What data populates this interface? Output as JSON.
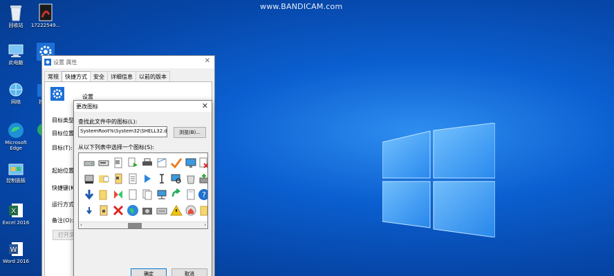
{
  "watermark": "www.BANDICAM.com",
  "desktop": {
    "icons": [
      {
        "label": "回收站",
        "icon": "recycle-bin-icon"
      },
      {
        "label": "17222549...",
        "icon": "image-file-icon"
      },
      {
        "label": "此电脑",
        "icon": "computer-icon"
      },
      {
        "label": "网络",
        "icon": "network-icon"
      },
      {
        "label": "控制面板",
        "icon": "control-panel-icon"
      },
      {
        "label": "Microsoft Edge",
        "icon": "edge-icon"
      },
      {
        "label": "Excel 2016",
        "icon": "excel-icon"
      },
      {
        "label": "Word 2016",
        "icon": "word-icon"
      },
      {
        "label": "控制",
        "icon": "settings-icon"
      }
    ]
  },
  "properties_dialog": {
    "title": "设置 属性",
    "tabs": [
      "常规",
      "快捷方式",
      "安全",
      "详细信息",
      "以前的版本"
    ],
    "active_tab": "快捷方式",
    "app_name": "设置",
    "fields": [
      "目标类型:",
      "目标位置:",
      "目标(T):",
      "起始位置(S):",
      "快捷键(K):",
      "运行方式(R):",
      "备注(O):"
    ],
    "open_location_button": "打开文"
  },
  "change_icon_dialog": {
    "title": "更改图标",
    "find_label": "查找此文件中的图标(L):",
    "path_value": "SystemRoot%\\System32\\SHELL32.dll",
    "browse_button": "浏览(B)...",
    "select_label": "从以下列表中选择一个图标(S):",
    "ok_button": "确定",
    "cancel_button": "取消"
  },
  "colors": {
    "desktop": "#0b5fd0",
    "logo": "#4fb0ff",
    "selection": "#0078d7"
  }
}
